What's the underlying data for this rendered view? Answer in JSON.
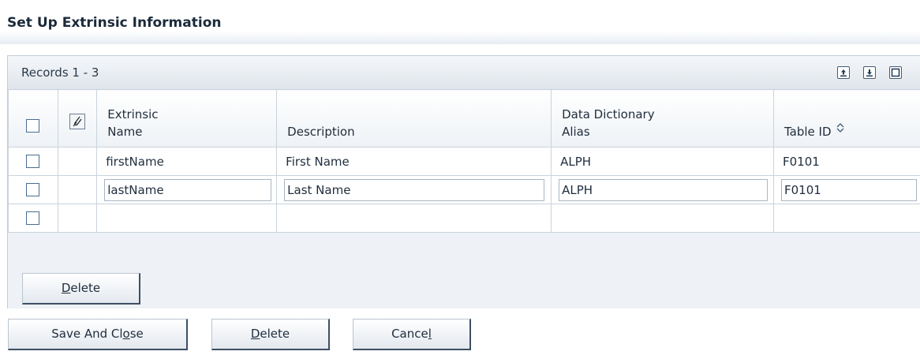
{
  "page": {
    "title": "Set Up Extrinsic Information"
  },
  "grid": {
    "records_label": "Records 1 - 3",
    "toolbar_icons": [
      "export-icon",
      "import-icon",
      "maximize-icon"
    ],
    "columns": [
      {
        "key": "select",
        "label": ""
      },
      {
        "key": "attachment",
        "label": ""
      },
      {
        "key": "extrinsic_name",
        "label_line1": "Extrinsic",
        "label_line2": "Name"
      },
      {
        "key": "description",
        "label": "Description"
      },
      {
        "key": "dd_alias",
        "label_line1": "Data Dictionary",
        "label_line2": "Alias"
      },
      {
        "key": "table_id",
        "label": "Table ID"
      }
    ],
    "rows": [
      {
        "extrinsic_name": "firstName",
        "description": "First Name",
        "dd_alias": "ALPH",
        "table_id": "F0101",
        "editable": false
      },
      {
        "extrinsic_name": "lastName",
        "description": "Last Name",
        "dd_alias": "ALPH",
        "table_id": "F0101",
        "editable": true
      },
      {
        "extrinsic_name": "",
        "description": "",
        "dd_alias": "",
        "table_id": "",
        "editable": false
      }
    ],
    "delete_button": {
      "label": "Delete",
      "mnemonic": "D"
    }
  },
  "footer": {
    "save_close": {
      "label": "Save And Close",
      "mnemonic": "o"
    },
    "delete": {
      "label": "Delete",
      "mnemonic": "D"
    },
    "cancel": {
      "label": "Cancel",
      "mnemonic": "l"
    }
  },
  "colors": {
    "title_text": "#1a2a3a",
    "grid_border": "#c9d3dd",
    "checkbox_border": "#4b6d92",
    "button_shadow": "#3e4f63"
  }
}
